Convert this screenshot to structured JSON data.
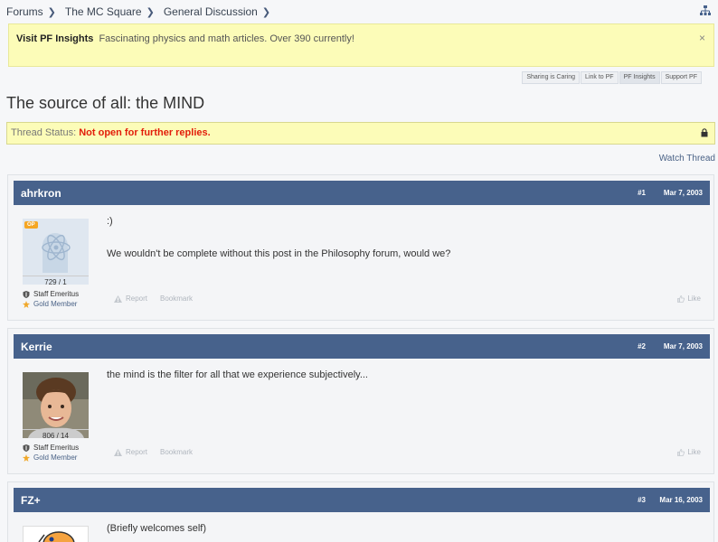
{
  "breadcrumb": [
    "Forums",
    "The MC Square",
    "General Discussion"
  ],
  "notice": {
    "title": "Visit PF Insights",
    "text": "Fascinating physics and math articles. Over 390 currently!",
    "close": "×"
  },
  "sharebar": [
    "Sharing is Caring",
    "Link to PF",
    "PF Insights",
    "Support PF"
  ],
  "thread": {
    "title": "The source of all: the MIND",
    "status_label": "Thread Status:",
    "status_value": "Not open for further replies.",
    "watch": "Watch Thread"
  },
  "posts": [
    {
      "author": "ahrkron",
      "number": "#1",
      "date": "Mar 7, 2003",
      "op_badge": "OP",
      "postcount": "729 / 1",
      "role1": "Staff Emeritus",
      "role2": "Gold Member",
      "line1": ":)",
      "line2": "We wouldn't be complete without this post in the Philosophy forum, would we?",
      "report": "Report",
      "bookmark": "Bookmark",
      "like": "Like"
    },
    {
      "author": "Kerrie",
      "number": "#2",
      "date": "Mar 7, 2003",
      "postcount": "806 / 14",
      "role1": "Staff Emeritus",
      "role2": "Gold Member",
      "line1": "the mind is the filter for all that we experience subjectively...",
      "report": "Report",
      "bookmark": "Bookmark",
      "like": "Like"
    },
    {
      "author": "FZ+",
      "number": "#3",
      "date": "Mar 16, 2003",
      "line1": "(Briefly welcomes self)"
    }
  ],
  "colors": {
    "header_bar": "#47628c",
    "notice_bg": "#fcfcb8",
    "status_red": "#e21d0a",
    "link": "#4a6286"
  }
}
